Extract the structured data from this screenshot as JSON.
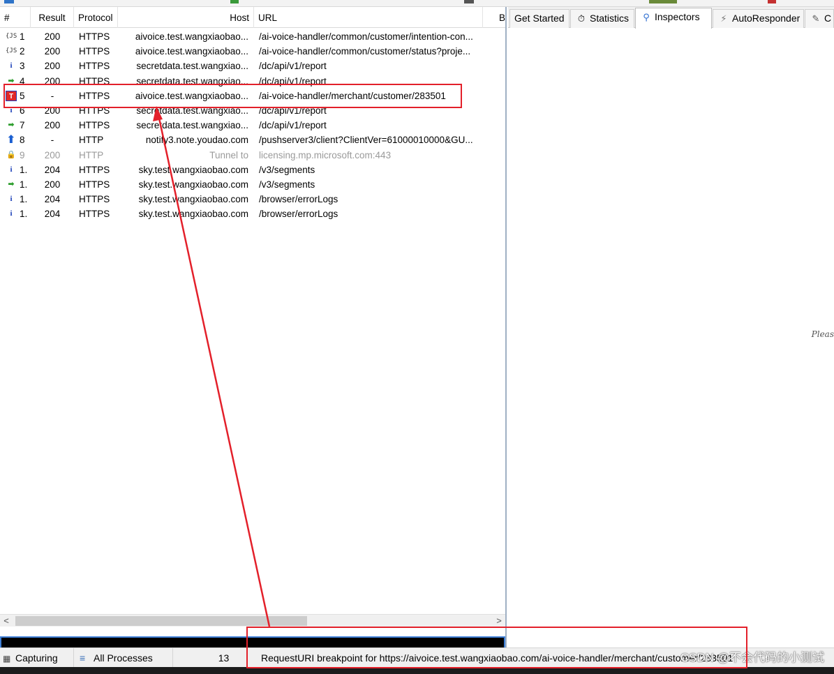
{
  "sessions": {
    "columns": {
      "num": "#",
      "result": "Result",
      "protocol": "Protocol",
      "host": "Host",
      "url": "URL",
      "body": "B"
    },
    "rows": [
      {
        "icon": "json-icon",
        "glyph": "{JS}",
        "num": "1",
        "result": "200",
        "protocol": "HTTPS",
        "host": "aivoice.test.wangxiaobao...",
        "url": "/ai-voice-handler/common/customer/intention-con...",
        "dim": false
      },
      {
        "icon": "json-icon",
        "glyph": "{JS}",
        "num": "2",
        "result": "200",
        "protocol": "HTTPS",
        "host": "aivoice.test.wangxiaobao...",
        "url": "/ai-voice-handler/common/customer/status?proje...",
        "dim": false
      },
      {
        "icon": "info-icon",
        "glyph": "i",
        "num": "3",
        "result": "200",
        "protocol": "HTTPS",
        "host": "secretdata.test.wangxiao...",
        "url": "/dc/api/v1/report",
        "dim": false
      },
      {
        "icon": "response-arrow-icon",
        "glyph": "➡",
        "num": "4",
        "result": "200",
        "protocol": "HTTPS",
        "host": "secretdata.test.wangxiao...",
        "url": "/dc/api/v1/report",
        "dim": false
      },
      {
        "icon": "breakpoint-icon",
        "glyph": "T",
        "num": "5",
        "result": "-",
        "protocol": "HTTPS",
        "host": "aivoice.test.wangxiaobao...",
        "url": "/ai-voice-handler/merchant/customer/283501",
        "dim": false
      },
      {
        "icon": "info-icon",
        "glyph": "i",
        "num": "6",
        "result": "200",
        "protocol": "HTTPS",
        "host": "secretdata.test.wangxiao...",
        "url": "/dc/api/v1/report",
        "dim": false
      },
      {
        "icon": "response-arrow-icon",
        "glyph": "➡",
        "num": "7",
        "result": "200",
        "protocol": "HTTPS",
        "host": "secretdata.test.wangxiao...",
        "url": "/dc/api/v1/report",
        "dim": false
      },
      {
        "icon": "upload-arrow-icon",
        "glyph": "⬆",
        "num": "8",
        "result": "-",
        "protocol": "HTTP",
        "host": "notify3.note.youdao.com",
        "url": "/pushserver3/client?ClientVer=61000010000&GU...",
        "dim": false
      },
      {
        "icon": "lock-icon",
        "glyph": "🔒",
        "num": "9",
        "result": "200",
        "protocol": "HTTP",
        "host": "Tunnel to",
        "url": "licensing.mp.microsoft.com:443",
        "dim": true
      },
      {
        "icon": "info-icon",
        "glyph": "i",
        "num": "1.",
        "result": "204",
        "protocol": "HTTPS",
        "host": "sky.test.wangxiaobao.com",
        "url": "/v3/segments",
        "dim": false
      },
      {
        "icon": "response-arrow-icon",
        "glyph": "➡",
        "num": "1.",
        "result": "200",
        "protocol": "HTTPS",
        "host": "sky.test.wangxiaobao.com",
        "url": "/v3/segments",
        "dim": false
      },
      {
        "icon": "info-icon",
        "glyph": "i",
        "num": "1.",
        "result": "204",
        "protocol": "HTTPS",
        "host": "sky.test.wangxiaobao.com",
        "url": "/browser/errorLogs",
        "dim": false
      },
      {
        "icon": "info-icon",
        "glyph": "i",
        "num": "1.",
        "result": "204",
        "protocol": "HTTPS",
        "host": "sky.test.wangxiaobao.com",
        "url": "/browser/errorLogs",
        "dim": false
      }
    ]
  },
  "tabs": [
    {
      "label": "Get Started",
      "icon": "",
      "active": false
    },
    {
      "label": "Statistics",
      "icon": "stopwatch-icon",
      "active": false
    },
    {
      "label": "Inspectors",
      "icon": "inspector-icon",
      "active": true
    },
    {
      "label": "AutoResponder",
      "icon": "lightning-icon",
      "active": false
    },
    {
      "label": "C",
      "icon": "composer-icon",
      "active": false
    }
  ],
  "right_pane": {
    "hint": "Pleas"
  },
  "statusbar": {
    "capturing": "Capturing",
    "processes": "All Processes",
    "count": "13",
    "message": "RequestURI breakpoint for https://aivoice.test.wangxiaobao.com/ai-voice-handler/merchant/customer/283501",
    "watermark": "CSDN @不会代码的小测试"
  },
  "colors": {
    "annotation": "#e3202a",
    "breakpoint_icon": "#e02828",
    "info_icon": "#1a3fb8"
  }
}
